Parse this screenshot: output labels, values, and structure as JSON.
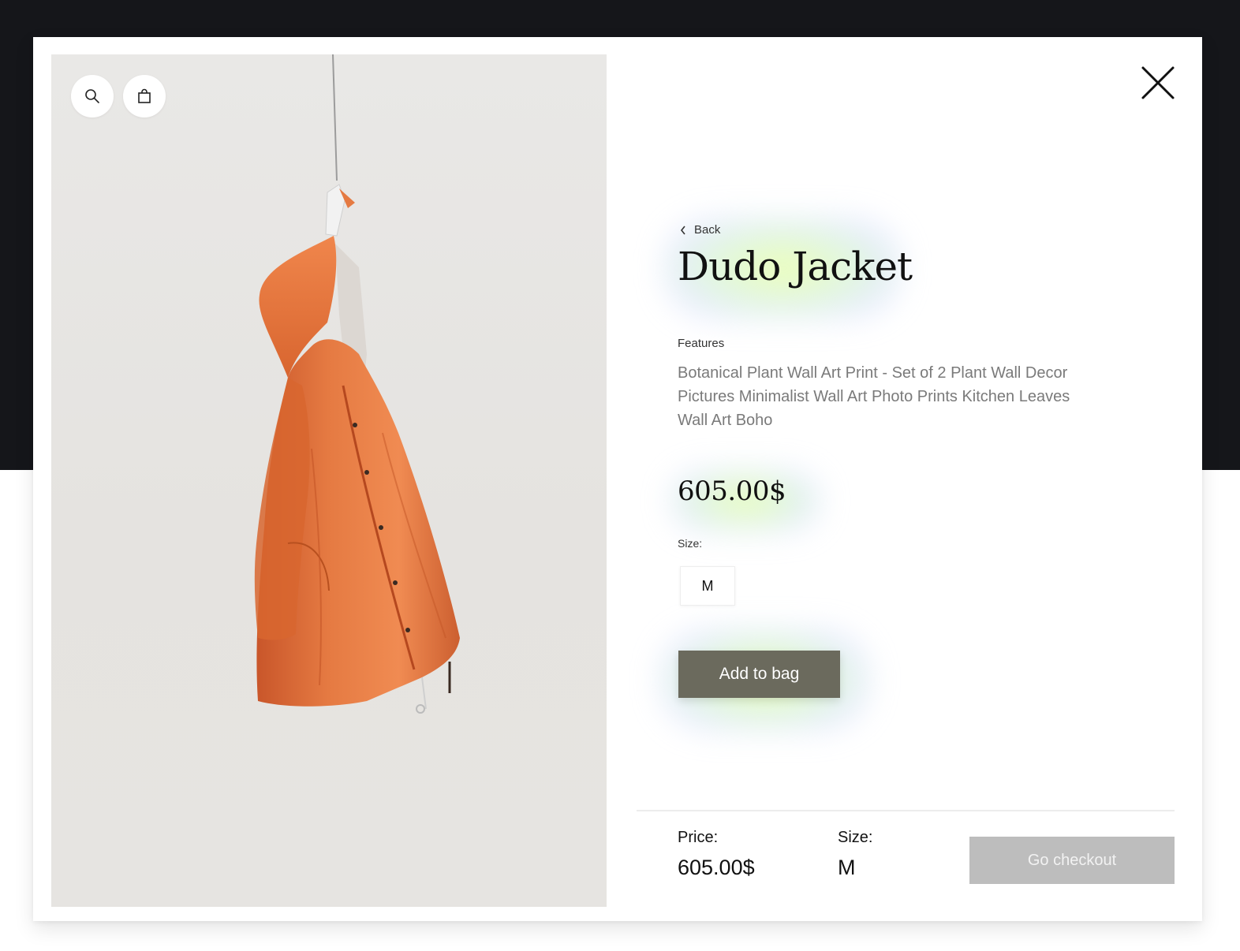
{
  "product": {
    "back_label": "Back",
    "title": "Dudo Jacket",
    "features_label": "Features",
    "features_text": "Botanical Plant Wall Art Print - Set of 2 Plant Wall Decor Pictures Minimalist Wall Art Photo Prints Kitchen Leaves Wall Art Boho",
    "price": "605.00$",
    "size_label": "Size:",
    "selected_size": "M",
    "add_to_bag_label": "Add to bag"
  },
  "summary": {
    "price_label": "Price:",
    "price_value": "605.00$",
    "size_label": "Size:",
    "size_value": "M",
    "checkout_label": "Go checkout"
  },
  "icons": {
    "search": "search-icon",
    "bag": "shopping-bag-icon",
    "close": "close-icon",
    "back": "chevron-left-icon"
  },
  "colors": {
    "backdrop": "#15161a",
    "jacket": "#e2733c",
    "add_button": "#6b6a5d",
    "checkout_button": "#bdbdbd"
  }
}
